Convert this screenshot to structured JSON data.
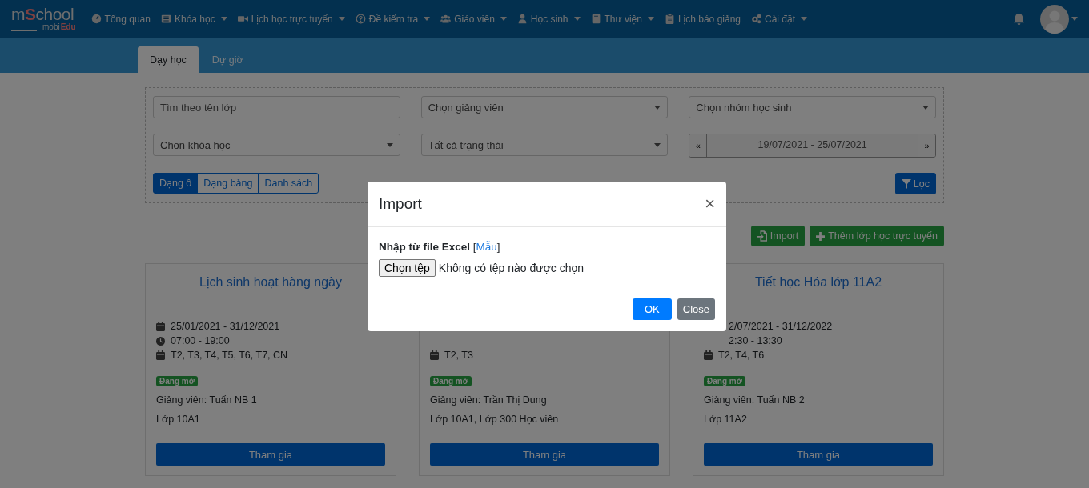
{
  "logo": {
    "lead": "m",
    "mark": "S",
    "tail": "chool",
    "sub_lead": "mobi",
    "sub_tail": "Edu"
  },
  "nav": [
    {
      "label": "Tổng quan",
      "dropdown": false
    },
    {
      "label": "Khóa học",
      "dropdown": true
    },
    {
      "label": "Lịch học trực tuyến",
      "dropdown": true
    },
    {
      "label": "Đề kiểm tra",
      "dropdown": true
    },
    {
      "label": "Giáo viên",
      "dropdown": true
    },
    {
      "label": "Học sinh",
      "dropdown": true
    },
    {
      "label": "Thư viện",
      "dropdown": true
    },
    {
      "label": "Lịch báo giảng",
      "dropdown": false
    },
    {
      "label": "Cài đặt",
      "dropdown": true
    }
  ],
  "tabs": [
    {
      "label": "Dạy học",
      "selected": true
    },
    {
      "label": "Dự giờ",
      "selected": false
    }
  ],
  "filters": [
    {
      "kind": "text",
      "placeholder": "Tìm theo tên lớp"
    },
    {
      "kind": "select",
      "value": "Chọn giảng viên"
    },
    {
      "kind": "select",
      "value": "Chọn nhóm học sinh"
    },
    {
      "kind": "select",
      "value": "Chon khóa học"
    },
    {
      "kind": "select",
      "value": "Tất cả trạng thái"
    },
    {
      "kind": "range",
      "prev": "«",
      "value": "19/07/2021 - 25/07/2021",
      "next": "»"
    }
  ],
  "views": [
    {
      "label": "Dạng ô",
      "selected": true
    },
    {
      "label": "Dạng bảng",
      "selected": false
    },
    {
      "label": "Danh sách",
      "selected": false
    }
  ],
  "filter_button": "Lọc",
  "actions": [
    {
      "label": "Import",
      "kind": "import"
    },
    {
      "label": "Thêm lớp học trực tuyến",
      "kind": "add"
    }
  ],
  "cards": [
    {
      "title": "Lịch sinh hoạt hàng ngày",
      "rows": [
        {
          "kind": "date",
          "text": "25/01/2021 - 31/12/2021"
        },
        {
          "kind": "time",
          "text": "07:00 - 19:00"
        },
        {
          "kind": "days",
          "text": "T2, T3, T4, T5, T6, T7, CN"
        }
      ],
      "status": "Đang mở",
      "teacher": "Giảng viên: Tuấn NB 1",
      "classes": "Lớp 10A1",
      "button": "Tham gia"
    },
    {
      "rows": [
        {
          "kind": "days",
          "text": "T2, T3"
        }
      ],
      "status": "Đang mở",
      "teacher": "Giảng viên: Trần Thị Dung",
      "classes": "Lớp 10A1, Lớp 300 Học viên",
      "button": "Tham gia"
    },
    {
      "title": "Tiết học Hóa lớp 11A2",
      "rows": [
        {
          "kind": "partial",
          "text": "2/07/2021 - 31/12/2022"
        },
        {
          "kind": "partial",
          "text": "2:30 - 13:30"
        },
        {
          "kind": "days",
          "text": "T2, T4, T6"
        }
      ],
      "status": "Đang mở",
      "teacher": "Giảng viên: Tuấn NB 2",
      "classes": "Lớp 11A2",
      "button": "Tham gia"
    }
  ],
  "modal": {
    "title": "Import",
    "close": "×",
    "label": "Nhập từ file Excel",
    "bracket_open": "[",
    "link": "Mẫu",
    "bracket_close": "]",
    "file_button": "Chọn tệp",
    "file_status": "Không có tệp nào được chọn",
    "ok": "OK",
    "cancel": "Close"
  }
}
